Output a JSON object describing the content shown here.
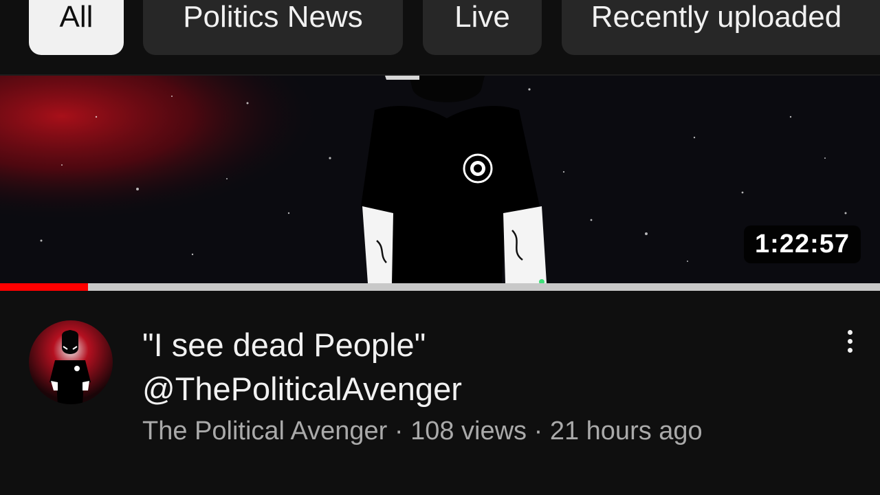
{
  "chips": [
    {
      "label": "All",
      "selected": true
    },
    {
      "label": "Politics News",
      "selected": false
    },
    {
      "label": "Live",
      "selected": false
    },
    {
      "label": "Recently uploaded",
      "selected": false
    }
  ],
  "video": {
    "duration": "1:22:57",
    "watch_progress": 0.1,
    "title_line1": "\"I see dead People\"",
    "title_line2": "@ThePoliticalAvenger",
    "channel": "The Political Avenger",
    "views": "108 views",
    "age": "21 hours ago",
    "separator": "·"
  },
  "icons": {
    "more": "more-vertical-icon",
    "avatar": "channel-avatar"
  },
  "colors": {
    "background": "#0f0f0f",
    "chip": "#272727",
    "chip_selected": "#f1f1f1",
    "progress": "#ff0000",
    "secondary_text": "#aaaaaa"
  }
}
